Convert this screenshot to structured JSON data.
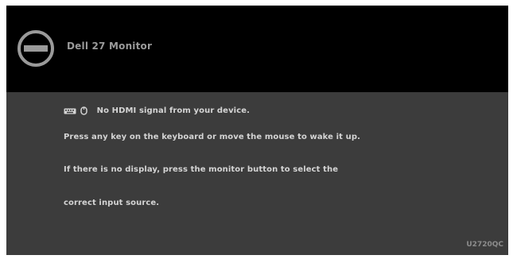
{
  "osd": {
    "title": "Dell 27 Monitor",
    "message": {
      "line1": "No HDMI signal from your device.",
      "line2": "Press any key on the keyboard or move the mouse to wake it up.",
      "line3": "If there is no display, press the monitor button to select the",
      "line4": "correct input source."
    },
    "footer_code": "U2720QC"
  },
  "icons": {
    "logo": "dell-logo-icon",
    "keyboard": "keyboard-icon",
    "mouse": "mouse-icon"
  },
  "colors": {
    "header_bg": "#000000",
    "body_bg": "#3c3c3c",
    "title_text": "#9a9a9a",
    "message_text": "#d4d4d4",
    "footer_text": "#8c8c8c"
  }
}
